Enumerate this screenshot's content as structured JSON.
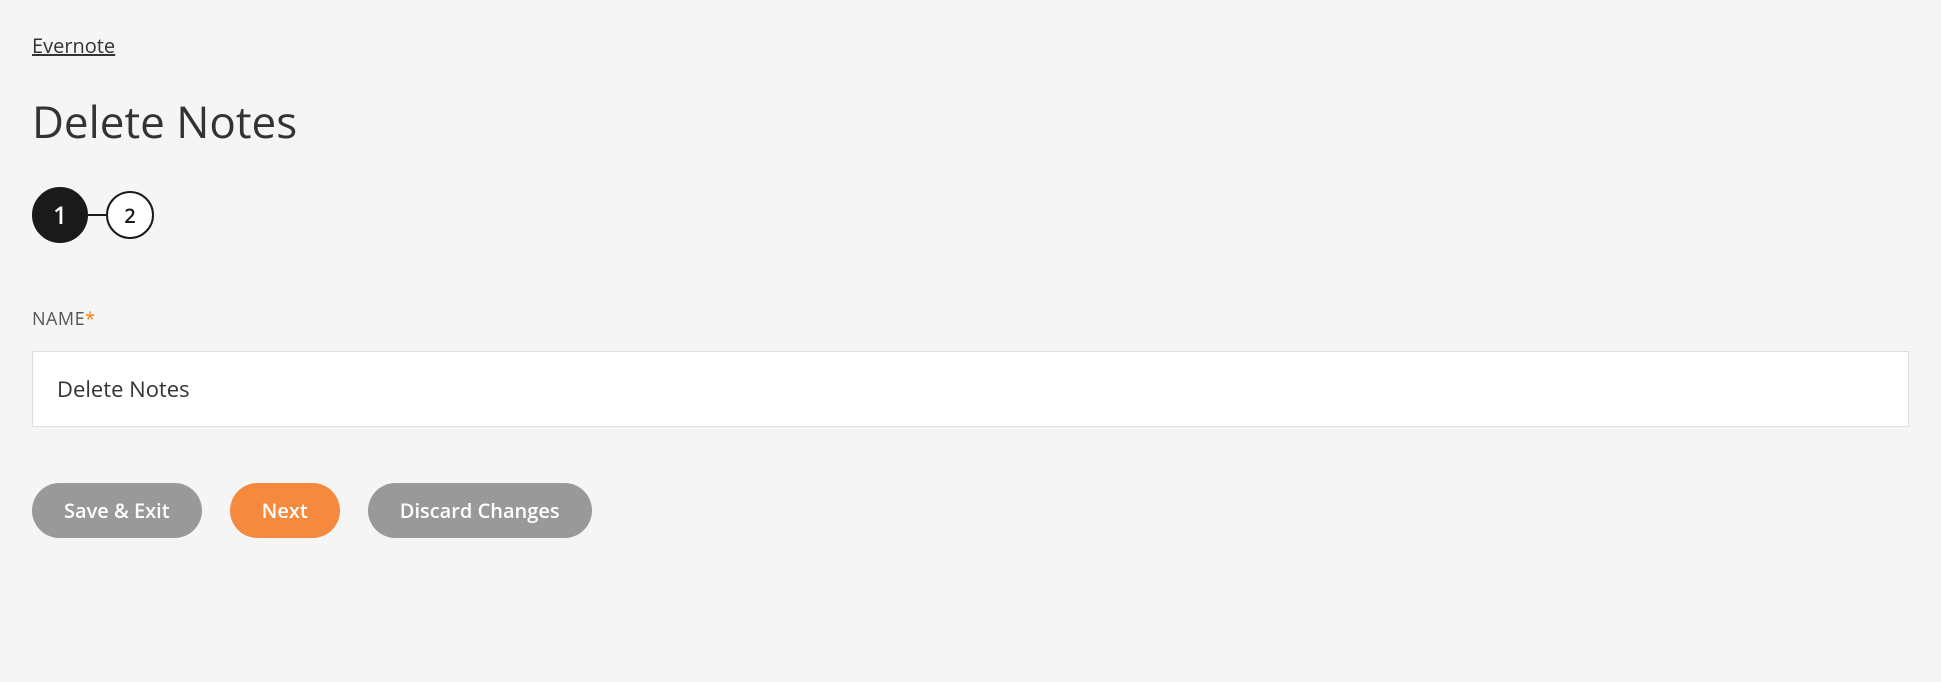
{
  "breadcrumb": {
    "label": "Evernote"
  },
  "page": {
    "title": "Delete Notes"
  },
  "stepper": {
    "steps": [
      {
        "num": "1"
      },
      {
        "num": "2"
      }
    ]
  },
  "form": {
    "name_label": "NAME",
    "required_marker": "*",
    "name_value": "Delete Notes"
  },
  "buttons": {
    "save_exit": "Save & Exit",
    "next": "Next",
    "discard": "Discard Changes"
  }
}
